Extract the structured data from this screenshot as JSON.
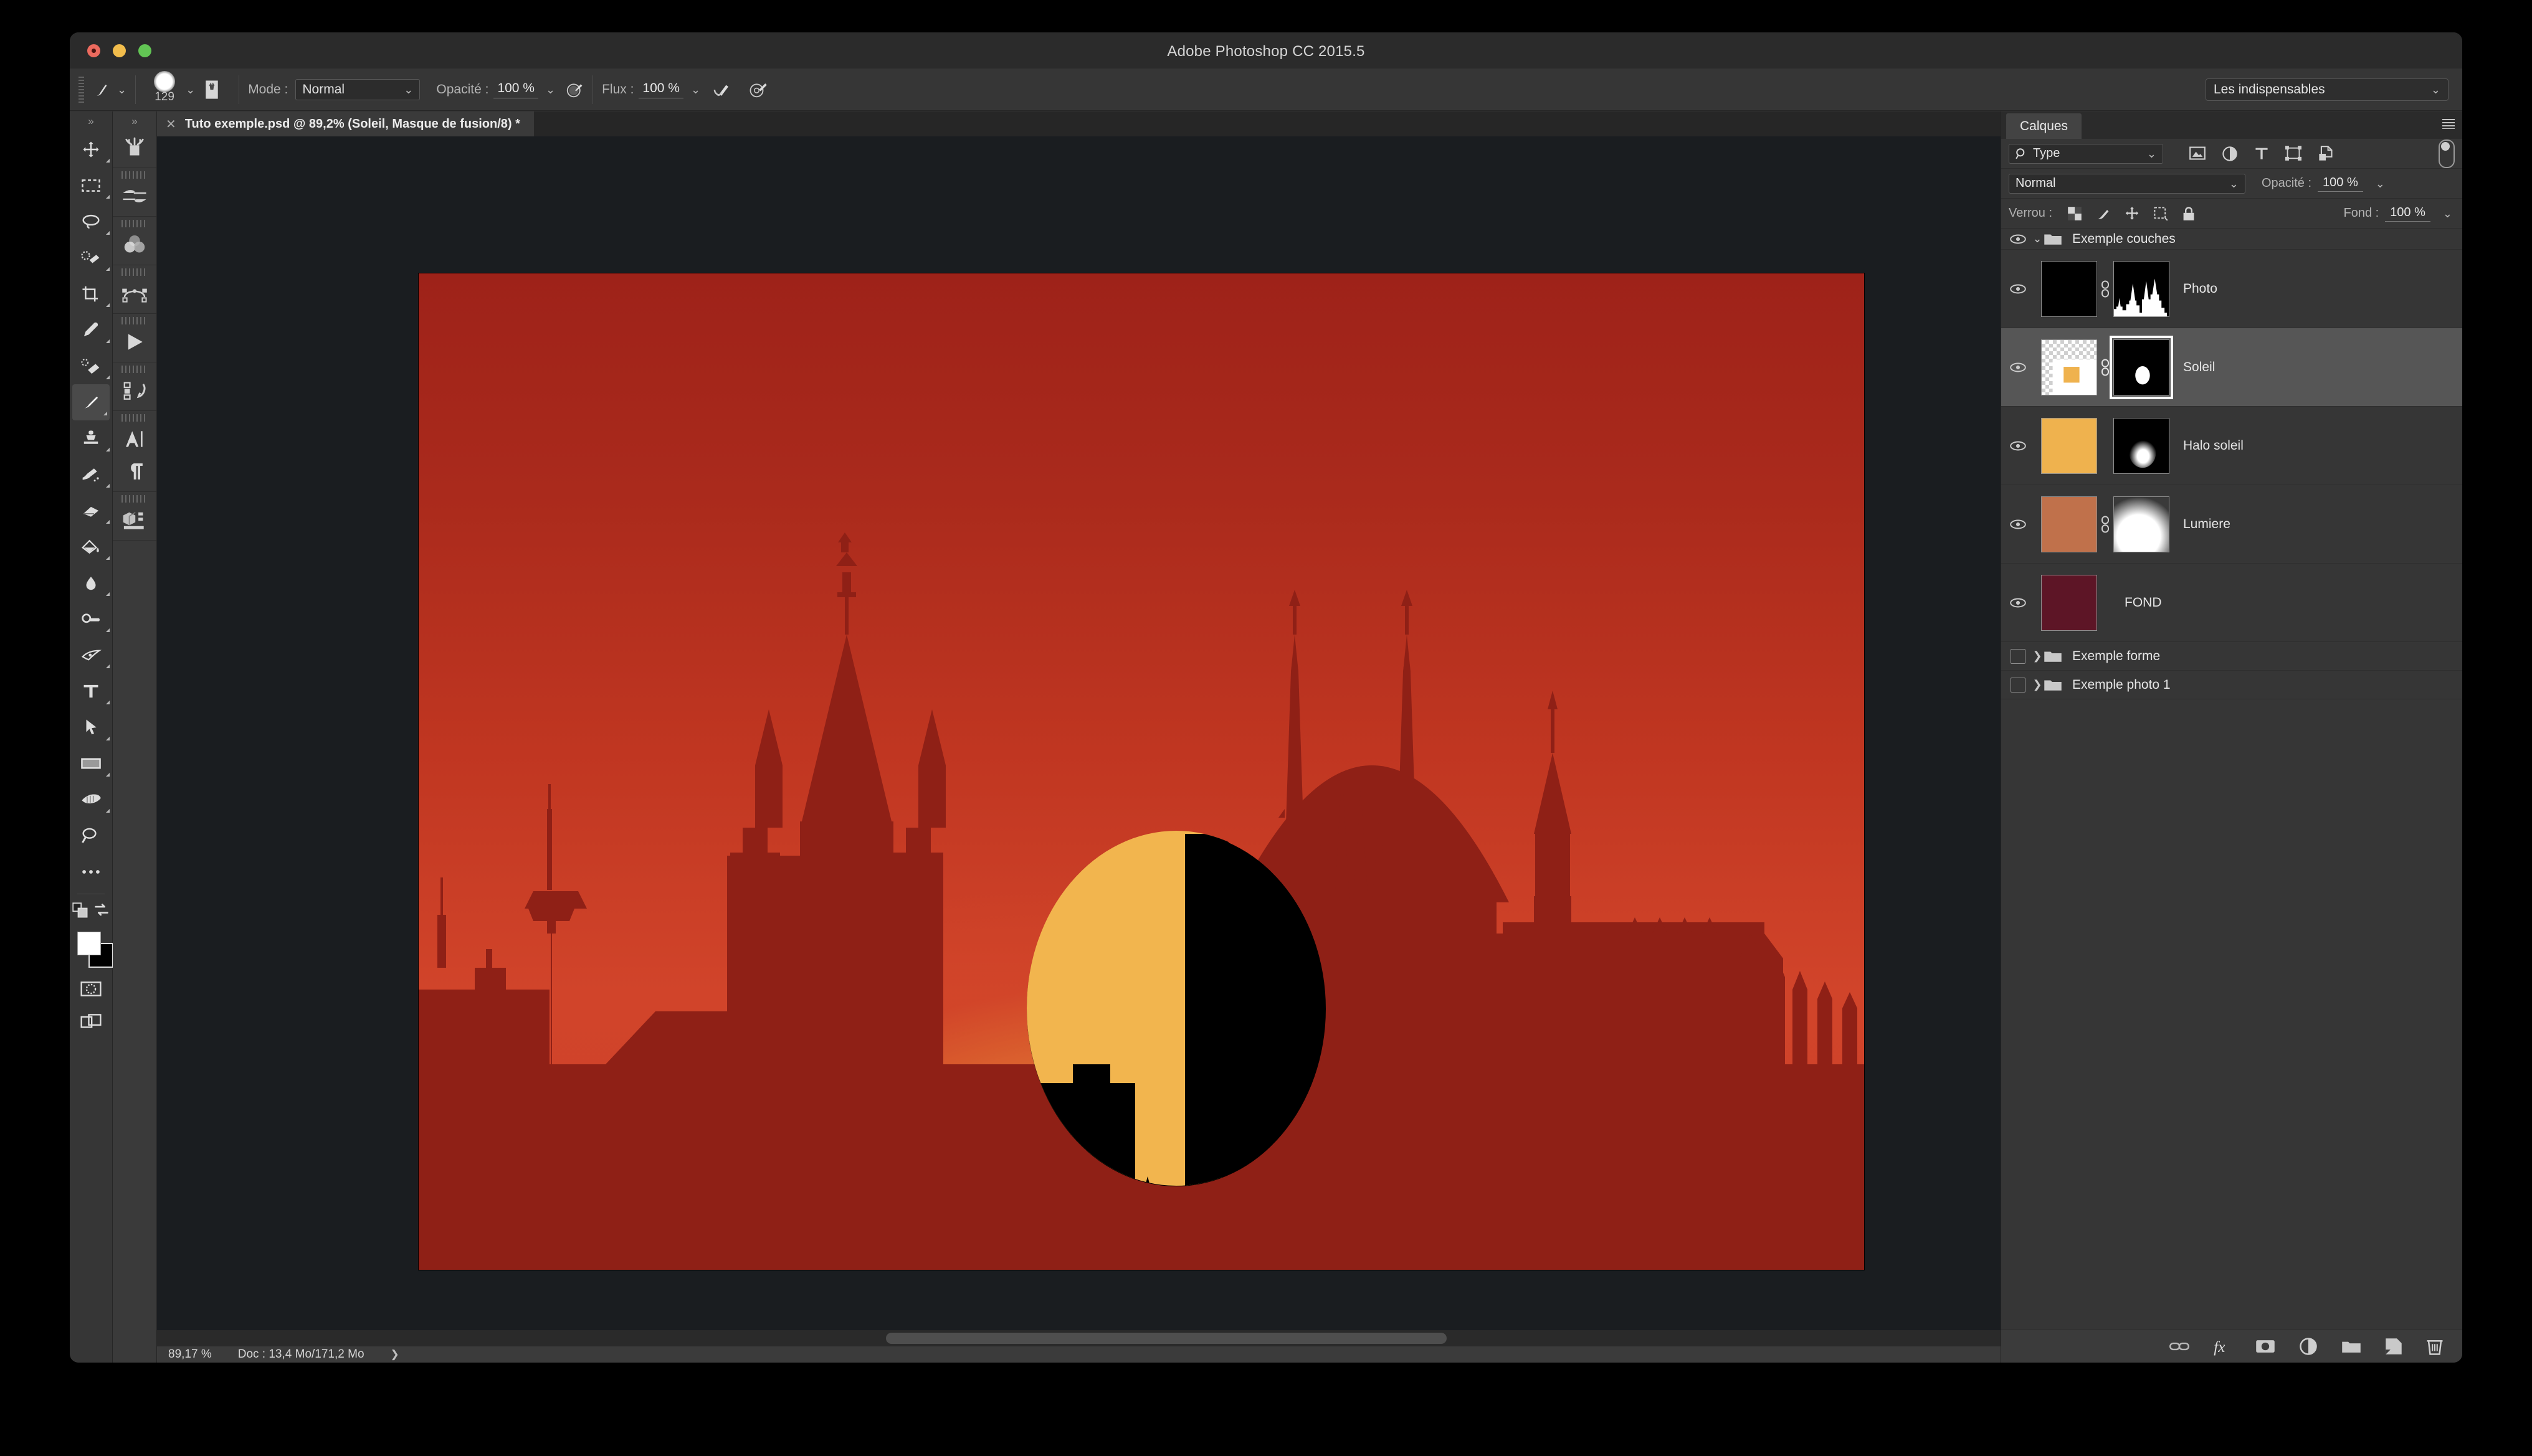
{
  "window": {
    "title": "Adobe Photoshop CC 2015.5",
    "traffic_lights": [
      "close-button",
      "minimize-button",
      "zoom-button"
    ]
  },
  "options_bar": {
    "tool_icon": "brush-tool-icon",
    "brush_size": "129",
    "brush_preset_icon": "brush-preset-picker-icon",
    "mode_label": "Mode :",
    "mode_value": "Normal",
    "opacity_label": "Opacité :",
    "opacity_value": "100 %",
    "opacity_pressure_icon": "pressure-opacity-icon",
    "flow_label": "Flux :",
    "flow_value": "100 %",
    "airbrush_icon": "airbrush-icon",
    "smoothing_icon": "smoothing-icon",
    "workspace_value": "Les indispensables"
  },
  "toolbar": {
    "items": [
      {
        "name": "move-tool",
        "icon": "move-icon",
        "active": false,
        "has_flyout": true
      },
      {
        "name": "marquee-tool",
        "icon": "rect-marquee-icon",
        "active": false,
        "has_flyout": true
      },
      {
        "name": "lasso-tool",
        "icon": "lasso-icon",
        "active": false,
        "has_flyout": true
      },
      {
        "name": "quick-selection-tool",
        "icon": "quick-selection-icon",
        "active": false,
        "has_flyout": true
      },
      {
        "name": "crop-tool",
        "icon": "crop-icon",
        "active": false,
        "has_flyout": true
      },
      {
        "name": "eyedropper-tool",
        "icon": "eyedropper-icon",
        "active": false,
        "has_flyout": true
      },
      {
        "name": "healing-brush-tool",
        "icon": "healing-brush-icon",
        "active": false,
        "has_flyout": true
      },
      {
        "name": "brush-tool",
        "icon": "brush-icon",
        "active": true,
        "has_flyout": true
      },
      {
        "name": "clone-stamp-tool",
        "icon": "clone-stamp-icon",
        "active": false,
        "has_flyout": true
      },
      {
        "name": "history-brush-tool",
        "icon": "history-brush-icon",
        "active": false,
        "has_flyout": true
      },
      {
        "name": "eraser-tool",
        "icon": "eraser-icon",
        "active": false,
        "has_flyout": true
      },
      {
        "name": "gradient-tool",
        "icon": "gradient-bucket-icon",
        "active": false,
        "has_flyout": true
      },
      {
        "name": "blur-tool",
        "icon": "blur-drop-icon",
        "active": false,
        "has_flyout": true
      },
      {
        "name": "dodge-tool",
        "icon": "dodge-icon",
        "active": false,
        "has_flyout": true
      },
      {
        "name": "pen-tool",
        "icon": "pen-icon",
        "active": false,
        "has_flyout": true
      },
      {
        "name": "type-tool",
        "icon": "type-T-icon",
        "active": false,
        "has_flyout": true
      },
      {
        "name": "path-selection-tool",
        "icon": "path-arrow-icon",
        "active": false,
        "has_flyout": true
      },
      {
        "name": "rectangle-shape-tool",
        "icon": "rectangle-icon",
        "active": false,
        "has_flyout": true
      },
      {
        "name": "hand-tool",
        "icon": "hand-icon",
        "active": false,
        "has_flyout": true
      },
      {
        "name": "zoom-tool",
        "icon": "magnifier-icon",
        "active": false,
        "has_flyout": false
      },
      {
        "name": "edit-toolbar",
        "icon": "ellipsis-icon",
        "active": false,
        "has_flyout": false
      }
    ],
    "default-colors-icon": "default-colors-icon",
    "swap-colors-icon": "swap-colors-icon",
    "foreground_color": "#ffffff",
    "background_color": "#000000",
    "quick-mask-icon": "quick-mask-icon",
    "screen-mode-icon": "screen-mode-icon"
  },
  "tool_panel_2": {
    "items": [
      {
        "name": "brushes-presets",
        "icon": "brush-jar-icon"
      },
      {
        "name": "brush-settings",
        "icon": "brush-settings-icon"
      },
      {
        "name": "color-channels",
        "icon": "color-circles-icon"
      },
      {
        "name": "paths",
        "icon": "bezier-path-icon"
      },
      {
        "name": "timeline-play",
        "icon": "play-triangle-icon"
      },
      {
        "name": "history-snapshots",
        "icon": "history-undo-icon"
      },
      {
        "name": "character-panel",
        "icon": "character-A-icon"
      },
      {
        "name": "paragraph-panel",
        "icon": "paragraph-pilcrow-icon"
      },
      {
        "name": "3d-panel",
        "icon": "cube-3d-icon"
      }
    ]
  },
  "document": {
    "tab_label": "Tuto exemple.psd @ 89,2% (Soleil, Masque de fusion/8) *",
    "close_icon": "close-tab-icon"
  },
  "status_bar": {
    "zoom": "89,17 %",
    "doc_info": "Doc : 13,4 Mo/171,2 Mo",
    "expand_icon": "chevron-right-icon"
  },
  "layers_panel": {
    "tab_label": "Calques",
    "menu_icon": "panel-menu-icon",
    "filter": {
      "search_icon": "search-icon",
      "filter_type_value": "Type",
      "icons": [
        "pixel-layer-filter-icon",
        "adjustment-layer-filter-icon",
        "type-layer-filter-icon",
        "shape-layer-filter-icon",
        "smart-object-filter-icon"
      ],
      "toggle_name": "filter-enable-toggle"
    },
    "blend_mode": "Normal",
    "opacity_label": "Opacité :",
    "opacity_value": "100 %",
    "lock_label": "Verrou :",
    "lock_icons": [
      "lock-transparent-pixels-icon",
      "lock-image-pixels-icon",
      "lock-position-icon",
      "lock-artboard-nesting-icon",
      "lock-all-icon"
    ],
    "fill_label": "Fond :",
    "fill_value": "100 %",
    "layers": [
      {
        "name": "Exemple couches",
        "kind": "group-open",
        "visible": true,
        "selected": false,
        "expand_icon": "chevron-down-icon",
        "folder_icon": "folder-icon"
      },
      {
        "name": "Photo",
        "kind": "layer",
        "visible": true,
        "selected": false,
        "thumb": "black-photo-thumb",
        "linked": true,
        "link_icon": "link-icon",
        "mask": "skyline-histogram-mask",
        "mask_active": false
      },
      {
        "name": "Soleil",
        "kind": "layer",
        "visible": true,
        "selected": true,
        "thumb": "transparent-yellow-square-thumb",
        "linked": true,
        "link_icon": "link-icon",
        "mask": "white-ellipse-on-black-mask",
        "mask_active": true
      },
      {
        "name": "Halo soleil",
        "kind": "layer",
        "visible": true,
        "selected": false,
        "thumb": "orange-fill-thumb",
        "linked": false,
        "mask": "soft-white-blob-mask",
        "mask_active": false
      },
      {
        "name": "Lumiere",
        "kind": "layer",
        "visible": true,
        "selected": false,
        "thumb": "terracotta-fill-thumb",
        "linked": true,
        "link_icon": "link-icon",
        "mask": "soft-white-gradient-mask",
        "mask_active": false
      },
      {
        "name": "FOND",
        "kind": "layer",
        "visible": true,
        "selected": false,
        "thumb": "dark-maroon-fill-thumb",
        "linked": false,
        "mask": null,
        "mask_active": false
      },
      {
        "name": "Exemple forme",
        "kind": "group-closed",
        "visible": false,
        "selected": false,
        "expand_icon": "chevron-right-icon",
        "folder_icon": "folder-icon"
      },
      {
        "name": "Exemple photo 1",
        "kind": "group-closed",
        "visible": false,
        "selected": false,
        "expand_icon": "chevron-right-icon",
        "folder_icon": "folder-icon"
      }
    ],
    "footer_icons": [
      "link-layers-icon",
      "layer-styles-fx-icon",
      "add-layer-mask-icon",
      "new-adjustment-layer-icon",
      "new-group-icon",
      "new-layer-icon",
      "delete-layer-icon"
    ]
  },
  "artwork": {
    "description": "Cologne skyline silhouette at sunset",
    "sky_top_color": "#9e2219",
    "sky_bottom_color": "#cf4128",
    "sun_color": "#f2b54e",
    "silhouette_color": "#8c1f15",
    "masked_sun_color": "#000000"
  },
  "thumb_colors": {
    "orange": "#efb24e",
    "terracotta": "#c0714b",
    "maroon": "#5d1526",
    "black": "#000000",
    "white": "#ffffff"
  }
}
